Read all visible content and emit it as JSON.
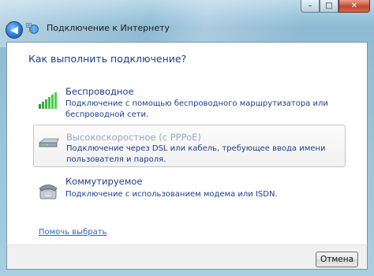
{
  "window": {
    "title": "Подключение к Интернету",
    "caption_minimize": "–",
    "caption_maximize": "□",
    "caption_close": "✕"
  },
  "nav": {
    "back_glyph": "◀"
  },
  "question": "Как выполнить подключение?",
  "options": [
    {
      "title": "Беспроводное",
      "description": "Подключение с помощью беспроводного маршрутизатора или беспроводной сети.",
      "icon": "wireless-signal-icon",
      "enabled": true
    },
    {
      "title": "Высокоскоростное (с PPPoE)",
      "description": "Подключение через DSL или кабель, требующее ввода имени пользователя и пароля.",
      "icon": "broadband-modem-icon",
      "enabled": false
    },
    {
      "title": "Коммутируемое",
      "description": "Подключение с использованием модема или ISDN.",
      "icon": "dialup-phone-icon",
      "enabled": true
    }
  ],
  "help_link": "Помочь выбрать",
  "footer": {
    "cancel_label": "Отмена"
  },
  "colors": {
    "link": "#2a63c7",
    "text_blue": "#1a3d8a",
    "disabled_title": "#9aa9bf"
  }
}
